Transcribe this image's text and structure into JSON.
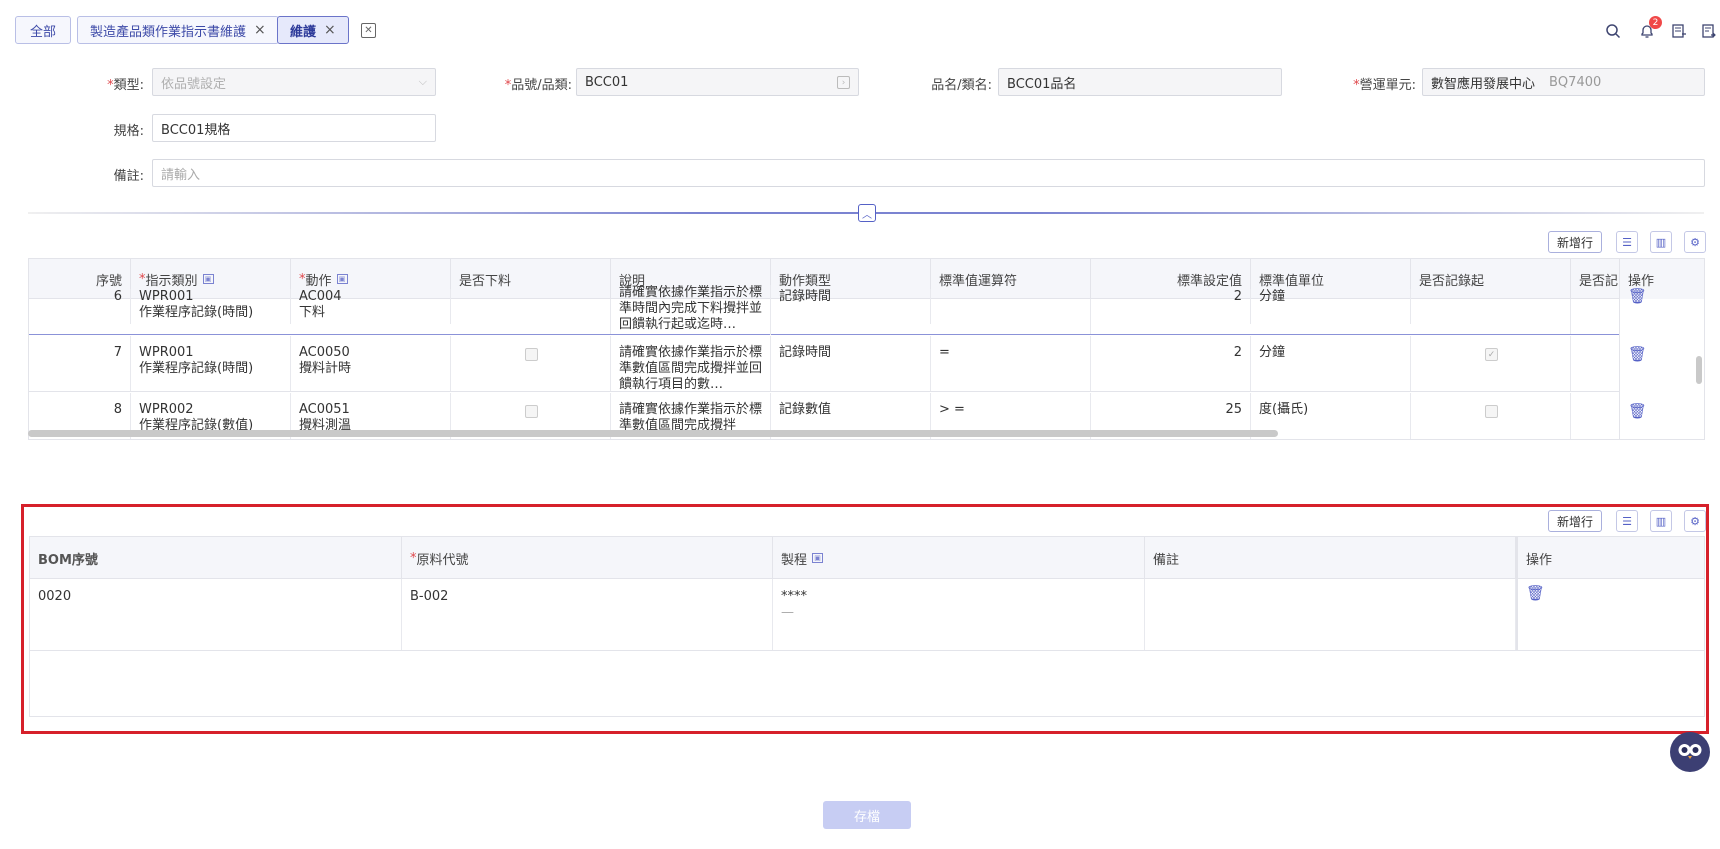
{
  "tabs": [
    {
      "label": "全部"
    },
    {
      "label": "製造產品類作業指示書維護",
      "close": "×"
    },
    {
      "label": "維護",
      "close": "×"
    }
  ],
  "topbar": {
    "notif_count": "2"
  },
  "form": {
    "type_label": "類型:",
    "type_value": "依品號設定",
    "item_label": "品號/品類:",
    "item_value": "BCC01",
    "name_label": "品名/類名:",
    "name_value": "BCC01品名",
    "unit_label": "營運單元:",
    "unit_value": "數智應用發展中心",
    "unit_code": "BQ7400",
    "spec_label": "規格:",
    "spec_value": "BCC01規格",
    "note_label": "備註:",
    "note_placeholder": "請輸入"
  },
  "grid1": {
    "add_label": "新增行",
    "headers": {
      "seq": "序號",
      "cat": "指示類別",
      "act": "動作",
      "down": "是否下料",
      "desc": "說明",
      "atype": "動作類型",
      "op": "標準值運算符",
      "stdval": "標準設定值",
      "stdunit": "標準值單位",
      "rec": "是否記錄起",
      "rec2": "是否記",
      "ops": "操作"
    },
    "rows": [
      {
        "seq": "6",
        "cat1": "WPR001",
        "cat2": "作業程序記錄(時間)",
        "act1": "AC004",
        "act2": "下料",
        "desc": "請確實依據作業指示於標準時間內完成下料攪拌並回饋執行起或迄時…",
        "atype": "記錄時間",
        "op": "",
        "val": "2",
        "unit": "分鐘"
      },
      {
        "seq": "7",
        "cat1": "WPR001",
        "cat2": "作業程序記錄(時間)",
        "act1": "AC0050",
        "act2": "攪料計時",
        "desc": "請確實依據作業指示於標準數值區間完成攪拌並回饋執行項目的數…",
        "atype": "記錄時間",
        "op": "=",
        "val": "2",
        "unit": "分鐘"
      },
      {
        "seq": "8",
        "cat1": "WPR002",
        "cat2": "作業程序記錄(數值)",
        "act1": "AC0051",
        "act2": "攪料測溫",
        "desc": "請確實依據作業指示於標準數值區間完成攪拌",
        "atype": "記錄數值",
        "op": "> =",
        "val": "25",
        "unit": "度(攝氏)"
      }
    ]
  },
  "grid2": {
    "add_label": "新增行",
    "headers": {
      "bom": "BOM序號",
      "mat": "原料代號",
      "proc": "製程",
      "note": "備註",
      "ops": "操作"
    },
    "rows": [
      {
        "bom": "0020",
        "mat": "B-002",
        "proc1": "****",
        "proc2": "—",
        "note": ""
      }
    ]
  },
  "footer": {
    "save_label": "存檔"
  }
}
